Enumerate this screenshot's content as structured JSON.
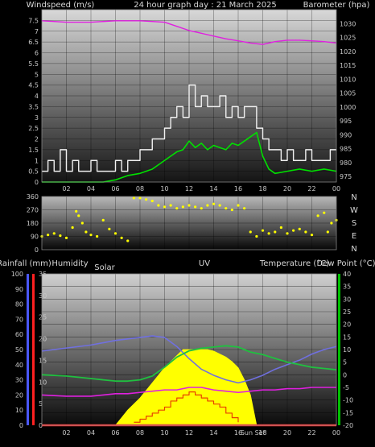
{
  "colors": {
    "windspeed": "#f0f0f0",
    "gust_avg": "#00e000",
    "barometer": "#e020e0",
    "direction": "#ffff00",
    "rain_axis": "#4a58ff",
    "humidity_axis": "#ff2020",
    "temp_axis": "#00c000",
    "humidity_line": "#7070e0",
    "temperature_line": "#20c040",
    "dewpoint_line": "#e020e0",
    "solar": "#ffff00",
    "uv": "#e84000",
    "rain": "#ff3030"
  },
  "chart_data": [
    {
      "type": "line",
      "title": "24 hour graph day : 21 March 2025",
      "ylabel": "Windspeed (m/s)",
      "y2label": "Barometer (hpa)",
      "ylim": [
        0,
        8
      ],
      "yticks": [
        "0",
        "0.5",
        "1",
        "1.5",
        "2",
        "2.5",
        "3",
        "3.5",
        "4",
        "4.5",
        "5",
        "5.5",
        "6",
        "6.5",
        "7",
        "7.5"
      ],
      "y2lim": [
        973,
        1035
      ],
      "y2ticks": [
        "975",
        "980",
        "985",
        "990",
        "995",
        "1000",
        "1005",
        "1010",
        "1015",
        "1020",
        "1025",
        "1030"
      ],
      "xlim": [
        0,
        24
      ],
      "xticks": [
        "02",
        "04",
        "06",
        "08",
        "10",
        "12",
        "14",
        "16",
        "18",
        "20",
        "22",
        "00"
      ],
      "series": [
        {
          "key": "windspeed",
          "x": [
            0,
            0.5,
            1,
            1.5,
            2,
            2.5,
            3,
            3.5,
            4,
            4.5,
            5,
            5.5,
            6,
            6.5,
            7,
            7.5,
            8,
            8.5,
            9,
            9.5,
            10,
            10.5,
            11,
            11.5,
            12,
            12.5,
            13,
            13.5,
            14,
            14.5,
            15,
            15.5,
            16,
            16.5,
            17,
            17.5,
            18,
            18.5,
            19,
            19.5,
            20,
            20.5,
            21,
            21.5,
            22,
            22.5,
            23,
            23.5,
            24
          ],
          "values": [
            0.5,
            1,
            0.5,
            1.5,
            0.5,
            1,
            0.5,
            0.5,
            1,
            0.5,
            0.5,
            0.5,
            1,
            0.5,
            1,
            1,
            1.5,
            1.5,
            2,
            2,
            2.5,
            3,
            3.5,
            3,
            4.5,
            3.5,
            4,
            3.5,
            3.5,
            4,
            3,
            3.5,
            3,
            3.5,
            3.5,
            2.5,
            2,
            1.5,
            1.5,
            1,
            1.5,
            1,
            1,
            1.5,
            1,
            1,
            1,
            1.5,
            1.5
          ]
        },
        {
          "key": "gust_avg",
          "x": [
            0,
            1,
            2,
            3,
            4,
            5,
            6,
            7,
            8,
            8.5,
            9,
            9.5,
            10,
            10.5,
            11,
            11.5,
            12,
            12.5,
            13,
            13.5,
            14,
            14.5,
            15,
            15.5,
            16,
            16.5,
            17,
            17.5,
            18,
            18.5,
            19,
            20,
            21,
            22,
            23,
            24
          ],
          "values": [
            0,
            0,
            0,
            0,
            0,
            0,
            0.1,
            0.3,
            0.4,
            0.5,
            0.6,
            0.8,
            1,
            1.2,
            1.4,
            1.5,
            1.9,
            1.6,
            1.8,
            1.5,
            1.7,
            1.6,
            1.5,
            1.8,
            1.7,
            1.9,
            2.1,
            2.3,
            1.2,
            0.6,
            0.4,
            0.5,
            0.6,
            0.5,
            0.6,
            0.5
          ]
        },
        {
          "key": "barometer",
          "x": [
            0,
            2,
            4,
            6,
            8,
            10,
            11,
            12,
            13,
            14,
            15,
            16,
            17,
            18,
            19,
            20,
            21,
            22,
            23,
            24
          ],
          "values": [
            1031,
            1030.5,
            1030.5,
            1031,
            1031,
            1030.5,
            1029,
            1027.5,
            1026.5,
            1025.5,
            1024.5,
            1023.8,
            1023,
            1022.5,
            1023.5,
            1024,
            1024,
            1023.8,
            1023.5,
            1023
          ]
        }
      ]
    },
    {
      "type": "scatter",
      "ylabel_right": [
        "N",
        "W",
        "S",
        "E",
        "N"
      ],
      "ylim": [
        0,
        360
      ],
      "yticks": [
        "0",
        "90",
        "180",
        "270",
        "360"
      ],
      "xlim": [
        0,
        24
      ],
      "series": [
        {
          "key": "direction",
          "x": [
            0,
            0.5,
            1,
            1.5,
            2,
            2.5,
            2.8,
            3,
            3.3,
            3.6,
            4,
            4.5,
            5,
            5.5,
            6,
            6.5,
            7,
            7.5,
            8,
            8.5,
            9,
            9.5,
            10,
            10.5,
            11,
            11.5,
            12,
            12.5,
            13,
            13.5,
            14,
            14.5,
            15,
            15.5,
            16,
            16.5,
            17,
            17.5,
            18,
            18.5,
            19,
            19.5,
            20,
            20.5,
            21,
            21.5,
            22,
            22.5,
            23,
            23.3,
            23.6,
            24
          ],
          "values": [
            90,
            100,
            110,
            95,
            80,
            150,
            260,
            230,
            180,
            120,
            100,
            90,
            200,
            140,
            110,
            80,
            60,
            350,
            350,
            340,
            330,
            300,
            290,
            300,
            280,
            290,
            300,
            290,
            280,
            300,
            310,
            300,
            280,
            270,
            300,
            280,
            120,
            90,
            130,
            110,
            120,
            150,
            110,
            130,
            140,
            120,
            100,
            230,
            250,
            120,
            180,
            200
          ]
        }
      ]
    },
    {
      "type": "line",
      "legend": [
        "Rainfall (mm)",
        "Humidity",
        "Solar",
        "UV",
        "Temperature (°C)",
        "Dew Point (°C)"
      ],
      "y_rain": [
        "0",
        "10",
        "20",
        "30",
        "40",
        "50",
        "60",
        "70",
        "80",
        "90",
        "100"
      ],
      "y_hum": [
        "0",
        "5",
        "10",
        "15",
        "20",
        "25",
        "30",
        "35"
      ],
      "y_temp": [
        "-20",
        "-15",
        "-10",
        "-5",
        "0",
        "5",
        "10",
        "15",
        "20",
        "25",
        "30",
        "35",
        "40"
      ],
      "xticks": [
        "02",
        "04",
        "06",
        "08",
        "10",
        "12",
        "14",
        "16",
        "18",
        "20",
        "22",
        "00"
      ],
      "sun_labels": [
        "Sun Set"
      ],
      "xlim": [
        0,
        24
      ],
      "series": [
        {
          "key": "humidity",
          "unit": "%",
          "x": [
            0,
            2,
            4,
            6,
            8,
            9,
            10,
            11,
            12,
            13,
            14,
            15,
            16,
            17,
            18,
            19,
            20,
            21,
            22,
            23,
            24
          ],
          "values": [
            49,
            51,
            53,
            56,
            58,
            59,
            58,
            52,
            44,
            37,
            33,
            30,
            28,
            30,
            33,
            37,
            40,
            43,
            47,
            50,
            52
          ]
        },
        {
          "key": "temperature",
          "unit": "°C",
          "x": [
            0,
            2,
            4,
            5,
            6,
            7,
            8,
            9,
            10,
            11,
            12,
            13,
            14,
            15,
            16,
            17,
            18,
            19,
            20,
            21,
            22,
            23,
            24
          ],
          "values": [
            0,
            -0.5,
            -1.5,
            -2,
            -2.5,
            -2.5,
            -2,
            -0.5,
            3,
            7,
            9.5,
            10.5,
            11,
            11.5,
            11,
            9,
            8,
            6.5,
            5,
            4,
            3,
            2.5,
            2
          ]
        },
        {
          "key": "dewpoint",
          "unit": "°C",
          "x": [
            0,
            2,
            4,
            5,
            6,
            7,
            8,
            9,
            10,
            11,
            12,
            13,
            14,
            15,
            16,
            17,
            18,
            19,
            20,
            21,
            22,
            23,
            24
          ],
          "values": [
            -8,
            -8.5,
            -8.5,
            -8,
            -7.5,
            -7.5,
            -7,
            -6.5,
            -6,
            -6,
            -5,
            -5,
            -6,
            -6.5,
            -7,
            -6.5,
            -6,
            -6,
            -5.5,
            -5.5,
            -5,
            -5,
            -5
          ]
        },
        {
          "key": "solar",
          "unit": "%",
          "x": [
            6,
            6.5,
            7,
            7.5,
            8,
            8.5,
            9,
            9.5,
            10,
            10.5,
            11,
            11.5,
            12,
            12.5,
            13,
            13.5,
            14,
            14.5,
            15,
            15.5,
            16,
            16.5,
            17,
            17.5
          ],
          "values": [
            0,
            5,
            10,
            14,
            18,
            23,
            28,
            33,
            38,
            42,
            46,
            50,
            50,
            50,
            50,
            50,
            49,
            47,
            45,
            42,
            38,
            30,
            20,
            0
          ]
        },
        {
          "key": "uv",
          "unit": "%",
          "x": [
            7.5,
            8,
            8.5,
            9,
            9.5,
            10,
            10.5,
            11,
            11.5,
            12,
            12.5,
            13,
            13.5,
            14,
            14.5,
            15,
            15.5,
            16
          ],
          "values": [
            2,
            4,
            6,
            8,
            10,
            12,
            16,
            18,
            20,
            22,
            20,
            18,
            16,
            14,
            12,
            8,
            5,
            2
          ]
        },
        {
          "key": "rain",
          "unit": "mm",
          "x": [
            0,
            24
          ],
          "values": [
            0,
            0
          ]
        }
      ]
    }
  ]
}
